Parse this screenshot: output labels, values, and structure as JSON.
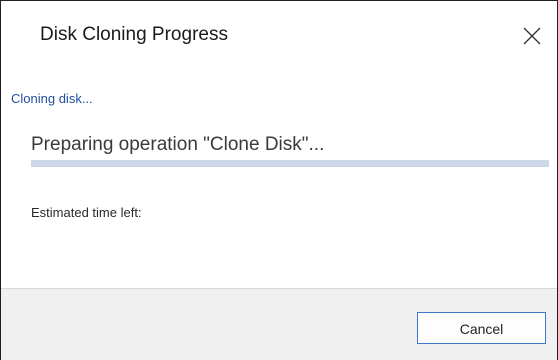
{
  "dialog": {
    "title": "Disk Cloning Progress",
    "close_icon": "close-icon"
  },
  "progress": {
    "status": "Cloning disk...",
    "operation": "Preparing operation \"Clone Disk\"...",
    "percent": 0,
    "estimated_time_label": "Estimated time left:",
    "track_color": "#ccd8e8",
    "fill_color": "#0a66c2"
  },
  "footer": {
    "cancel_label": "Cancel"
  },
  "colors": {
    "status_text": "#1f4e9c",
    "button_border": "#3a78c9",
    "footer_bg": "#f0f0f0"
  }
}
